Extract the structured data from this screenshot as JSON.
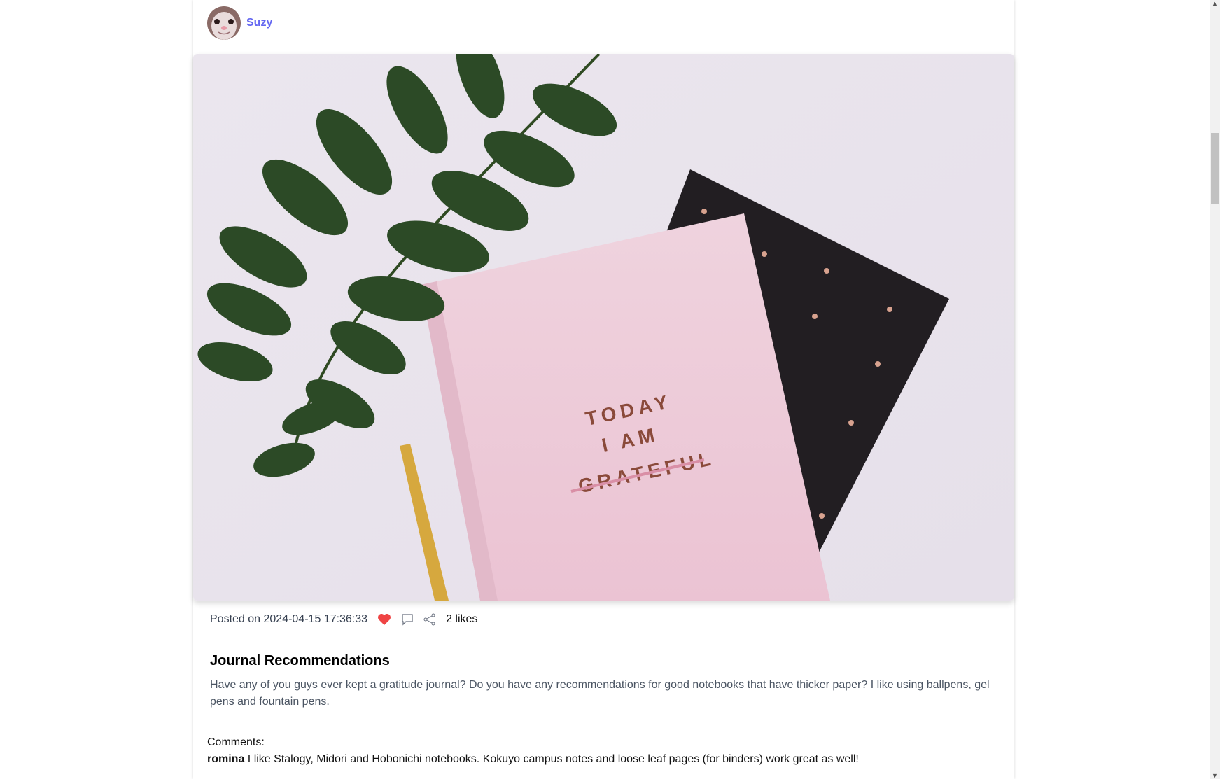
{
  "post": {
    "author": "Suzy",
    "posted": "Posted on 2024-04-15 17:36:33",
    "likes": "2 likes",
    "liked": true,
    "title": "Journal Recommendations",
    "body": "Have any of you guys ever kept a gratitude journal? Do you have any recommendations for good notebooks that have thicker paper? I like using ballpens, gel pens and fountain pens.",
    "image_text": "TODAY I AM GRATEFUL"
  },
  "comments": {
    "label": "Comments:",
    "items": [
      {
        "user": "romina",
        "text": "I like Stalogy, Midori and Hobonichi notebooks. Kokuyo campus notes and loose leaf pages (for binders) work great as well!"
      }
    ]
  },
  "colors": {
    "accent": "#6366f1",
    "heart": "#ef4444"
  }
}
